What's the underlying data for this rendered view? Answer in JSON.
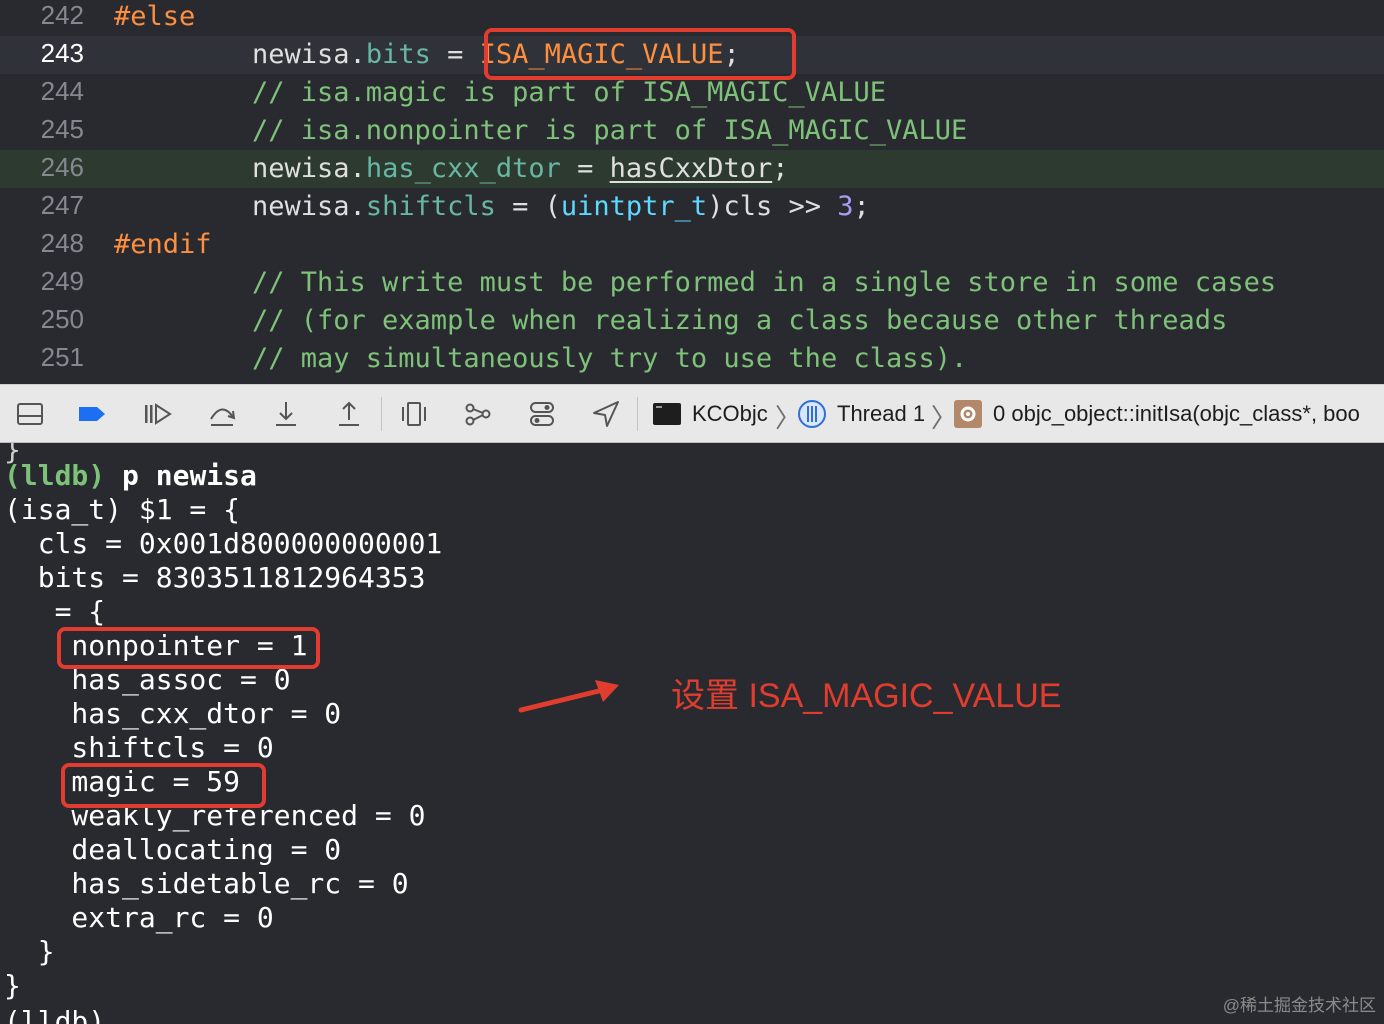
{
  "editor": {
    "lines": [
      {
        "num": "242",
        "text": "#else"
      },
      {
        "num": "243",
        "lhs": "newisa",
        "dot": ".",
        "prop": "bits",
        "eq": " = ",
        "value": "ISA_MAGIC_VALUE",
        "end": ";"
      },
      {
        "num": "244",
        "text": "// isa.magic is part of ISA_MAGIC_VALUE"
      },
      {
        "num": "245",
        "text": "// isa.nonpointer is part of ISA_MAGIC_VALUE"
      },
      {
        "num": "246",
        "lhs": "newisa",
        "dot": ".",
        "prop": "has_cxx_dtor",
        "eq": " = ",
        "value": "hasCxxDtor",
        "end": ";"
      },
      {
        "num": "247",
        "lhs": "newisa",
        "dot": ".",
        "prop": "shiftcls",
        "eq": " = (",
        "type": "uintptr_t",
        "mid": ")cls >> ",
        "number": "3",
        "end": ";"
      },
      {
        "num": "248",
        "text": "#endif"
      },
      {
        "num": "249",
        "text": "// This write must be performed in a single store in some cases"
      },
      {
        "num": "250",
        "text": "// (for example when realizing a class because other threads"
      },
      {
        "num": "251",
        "text": "// may simultaneously try to use the class)."
      }
    ]
  },
  "debugbar": {
    "icons": [
      "toggle-console-icon",
      "breakpoints-icon",
      "continue-icon",
      "step-over-icon",
      "step-into-icon",
      "step-out-icon",
      "view-hierarchy-icon",
      "memory-graph-icon",
      "environment-overrides-icon",
      "location-icon"
    ],
    "target": "KCObjc",
    "thread": "Thread 1",
    "frame": "0 objc_object::initIsa(objc_class*, boo"
  },
  "console": {
    "prompt": "(lldb)",
    "command": " p newisa",
    "lines": [
      "(isa_t) $1 = {",
      "  cls = 0x001d800000000001",
      "  bits = 8303511812964353",
      "   = {",
      "    nonpointer = 1",
      "    has_assoc = 0",
      "    has_cxx_dtor = 0",
      "    shiftcls = 0",
      "    magic = 59",
      "    weakly_referenced = 0",
      "    deallocating = 0",
      "    has_sidetable_rc = 0",
      "    extra_rc = 0",
      "  }",
      "}"
    ]
  },
  "annotation": "设置 ISA_MAGIC_VALUE",
  "watermark": "@稀土掘金技术社区",
  "colors": {
    "highlight": "#e23b2f",
    "comment": "#7ec279",
    "preprocessor": "#fd8f3f",
    "property": "#67b7a4"
  }
}
